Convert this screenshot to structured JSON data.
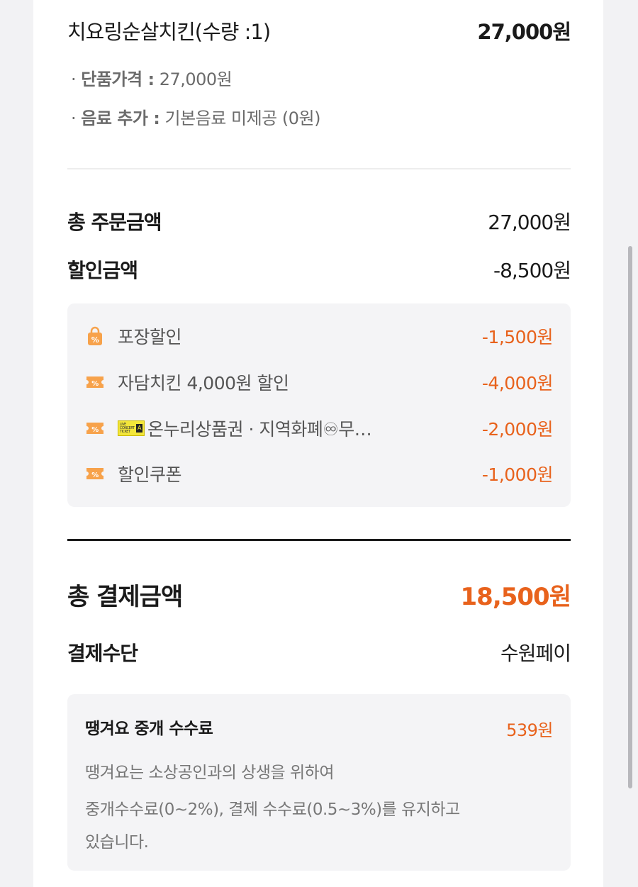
{
  "item": {
    "name": "치요링순살치킨(수량 :1)",
    "price": "27,000원",
    "options": [
      {
        "label": "단품가격 :",
        "value": "27,000원"
      },
      {
        "label": "음료 추가 :",
        "value": "기본음료 미제공 (0원)"
      }
    ]
  },
  "summary": {
    "order_total_label": "총 주문금액",
    "order_total_value": "27,000원",
    "discount_label": "할인금액",
    "discount_value": "-8,500원"
  },
  "discounts": [
    {
      "icon": "shopping-bag-percent-icon",
      "label": "포장할인",
      "value": "-1,500원"
    },
    {
      "icon": "coupon-percent-icon",
      "label": "자담치킨 4,000원 할인",
      "value": "-4,000원"
    },
    {
      "icon": "coupon-percent-icon",
      "label": "온누리상품권 · 지역화폐♾무…",
      "value": "-2,000원",
      "badge": {
        "line1": "LIVE",
        "line2": "CONCERT",
        "line3": "TICKET",
        "mark": "A"
      }
    },
    {
      "icon": "coupon-percent-icon",
      "label": "할인쿠폰",
      "value": "-1,000원"
    }
  ],
  "payment": {
    "total_label": "총 결제금액",
    "total_value": "18,500원",
    "method_label": "결제수단",
    "method_value": "수원페이"
  },
  "fee": {
    "title": "땡겨요 중개 수수료",
    "value": "539원",
    "desc_lines": [
      "땡겨요는 소상공인과의 상생을 위하여",
      "중개수수료(0~2%), 결제 수수료(0.5~3%)를 유지하고",
      "있습니다."
    ]
  },
  "colors": {
    "accent": "#e8621c",
    "icon_orange": "#f7a24b",
    "box_bg": "#f4f4f6"
  }
}
